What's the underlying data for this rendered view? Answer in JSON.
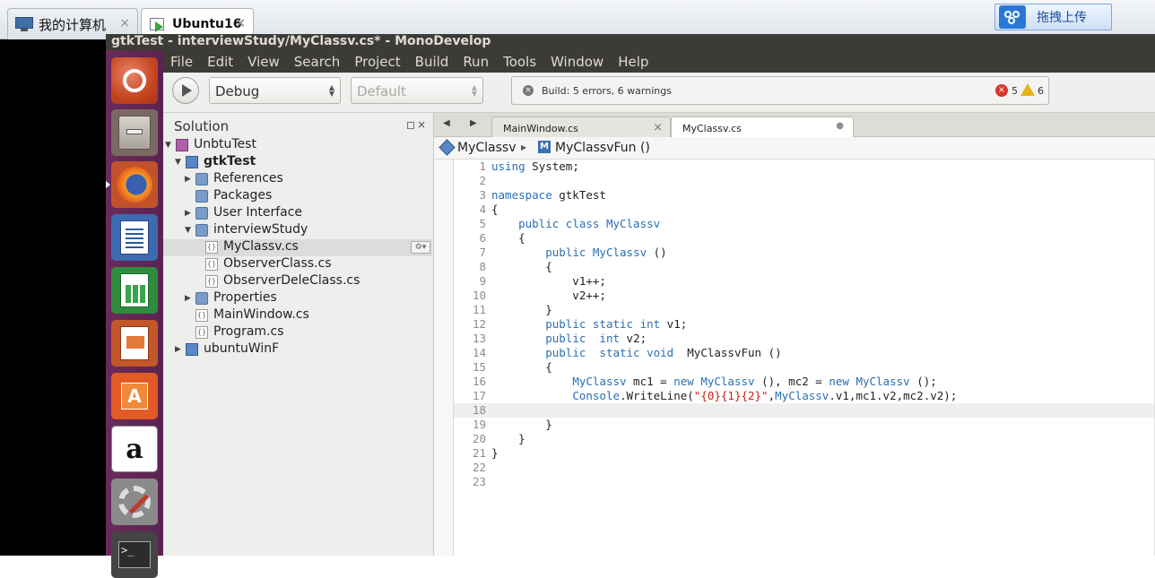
{
  "vm_tabs": [
    {
      "label": "我的计算机",
      "close": "×"
    },
    {
      "label": "Ubuntu16",
      "close": "×"
    }
  ],
  "upload_button": "拖拽上传",
  "window_title": "gtkTest - interviewStudy/MyClassv.cs* - MonoDevelop",
  "menu": [
    "File",
    "Edit",
    "View",
    "Search",
    "Project",
    "Build",
    "Run",
    "Tools",
    "Window",
    "Help"
  ],
  "toolbar": {
    "config": "Debug",
    "platform": "Default",
    "build_status": "Build: 5 errors, 6 warnings",
    "error_count": "5",
    "warning_count": "6"
  },
  "solution": {
    "title": "Solution",
    "items": [
      {
        "label": "UnbtuTest",
        "type": "solution",
        "depth": 0,
        "expanded": true
      },
      {
        "label": "gtkTest",
        "type": "project",
        "depth": 1,
        "expanded": true,
        "bold": true
      },
      {
        "label": "References",
        "type": "folder",
        "depth": 2,
        "expanded": false
      },
      {
        "label": "Packages",
        "type": "folder",
        "depth": 2,
        "expanded": null
      },
      {
        "label": "User Interface",
        "type": "folder",
        "depth": 2,
        "expanded": false
      },
      {
        "label": "interviewStudy",
        "type": "folder",
        "depth": 2,
        "expanded": true
      },
      {
        "label": "MyClassv.cs",
        "type": "file",
        "depth": 3,
        "expanded": null,
        "selected": true
      },
      {
        "label": "ObserverClass.cs",
        "type": "file",
        "depth": 3,
        "expanded": null
      },
      {
        "label": "ObserverDeleClass.cs",
        "type": "file",
        "depth": 3,
        "expanded": null
      },
      {
        "label": "Properties",
        "type": "folder",
        "depth": 2,
        "expanded": false
      },
      {
        "label": "MainWindow.cs",
        "type": "file",
        "depth": 2,
        "expanded": null
      },
      {
        "label": "Program.cs",
        "type": "file",
        "depth": 2,
        "expanded": null
      },
      {
        "label": "ubuntuWinF",
        "type": "project",
        "depth": 1,
        "expanded": false
      }
    ]
  },
  "editor": {
    "tabs": [
      {
        "label": "MainWindow.cs",
        "close": "×",
        "active": false
      },
      {
        "label": "MyClassv.cs",
        "close": "●",
        "active": true
      }
    ],
    "path_class": "MyClassv",
    "path_member": "MyClassvFun ()",
    "current_line": 18,
    "lines": [
      [
        [
          "kw",
          "using"
        ],
        [
          "",
          " System;"
        ]
      ],
      [],
      [
        [
          "kw",
          "namespace"
        ],
        [
          "",
          " gtkTest"
        ]
      ],
      [
        [
          "",
          "{"
        ]
      ],
      [
        [
          "",
          "    "
        ],
        [
          "kw",
          "public class "
        ],
        [
          "ty",
          "MyClassv"
        ]
      ],
      [
        [
          "",
          "    {"
        ]
      ],
      [
        [
          "",
          "        "
        ],
        [
          "kw",
          "public "
        ],
        [
          "ty",
          "MyClassv"
        ],
        [
          "",
          " ()"
        ]
      ],
      [
        [
          "",
          "        {"
        ]
      ],
      [
        [
          "",
          "            v1++;"
        ]
      ],
      [
        [
          "",
          "            v2++;"
        ]
      ],
      [
        [
          "",
          "        }"
        ]
      ],
      [
        [
          "",
          "        "
        ],
        [
          "kw",
          "public static int"
        ],
        [
          "",
          " v1;"
        ]
      ],
      [
        [
          "",
          "        "
        ],
        [
          "kw",
          "public  int"
        ],
        [
          "",
          " v2;"
        ]
      ],
      [
        [
          "",
          "        "
        ],
        [
          "kw",
          "public  static void"
        ],
        [
          "",
          "  MyClassvFun ()"
        ]
      ],
      [
        [
          "",
          "        {"
        ]
      ],
      [
        [
          "",
          "            "
        ],
        [
          "ty",
          "MyClassv"
        ],
        [
          "",
          " mc1 = "
        ],
        [
          "kw",
          "new "
        ],
        [
          "ty",
          "MyClassv"
        ],
        [
          "",
          " (), mc2 = "
        ],
        [
          "kw",
          "new "
        ],
        [
          "ty",
          "MyClassv"
        ],
        [
          "",
          " ();"
        ]
      ],
      [
        [
          "",
          "            "
        ],
        [
          "ty",
          "Console"
        ],
        [
          "",
          ".WriteLine("
        ],
        [
          "st",
          "\"{0}{1}{2}\""
        ],
        [
          "",
          ","
        ],
        [
          "ty",
          "MyClassv"
        ],
        [
          "",
          ".v1,mc1.v2,mc2.v2);"
        ]
      ],
      [],
      [
        [
          "",
          "        }"
        ]
      ],
      [
        [
          "",
          "    }"
        ]
      ],
      [
        [
          "",
          "}"
        ]
      ],
      [],
      []
    ]
  },
  "launcher": [
    "ubuntu-icon",
    "files-icon",
    "firefox-icon",
    "writer-icon",
    "calc-icon",
    "impress-icon",
    "software-center-icon",
    "amazon-icon",
    "settings-icon",
    "terminal-icon"
  ],
  "colors": {
    "accent": "#2a6fb5",
    "launcher": "#5e2750",
    "error": "#d9362c",
    "warning": "#e8b31a"
  }
}
